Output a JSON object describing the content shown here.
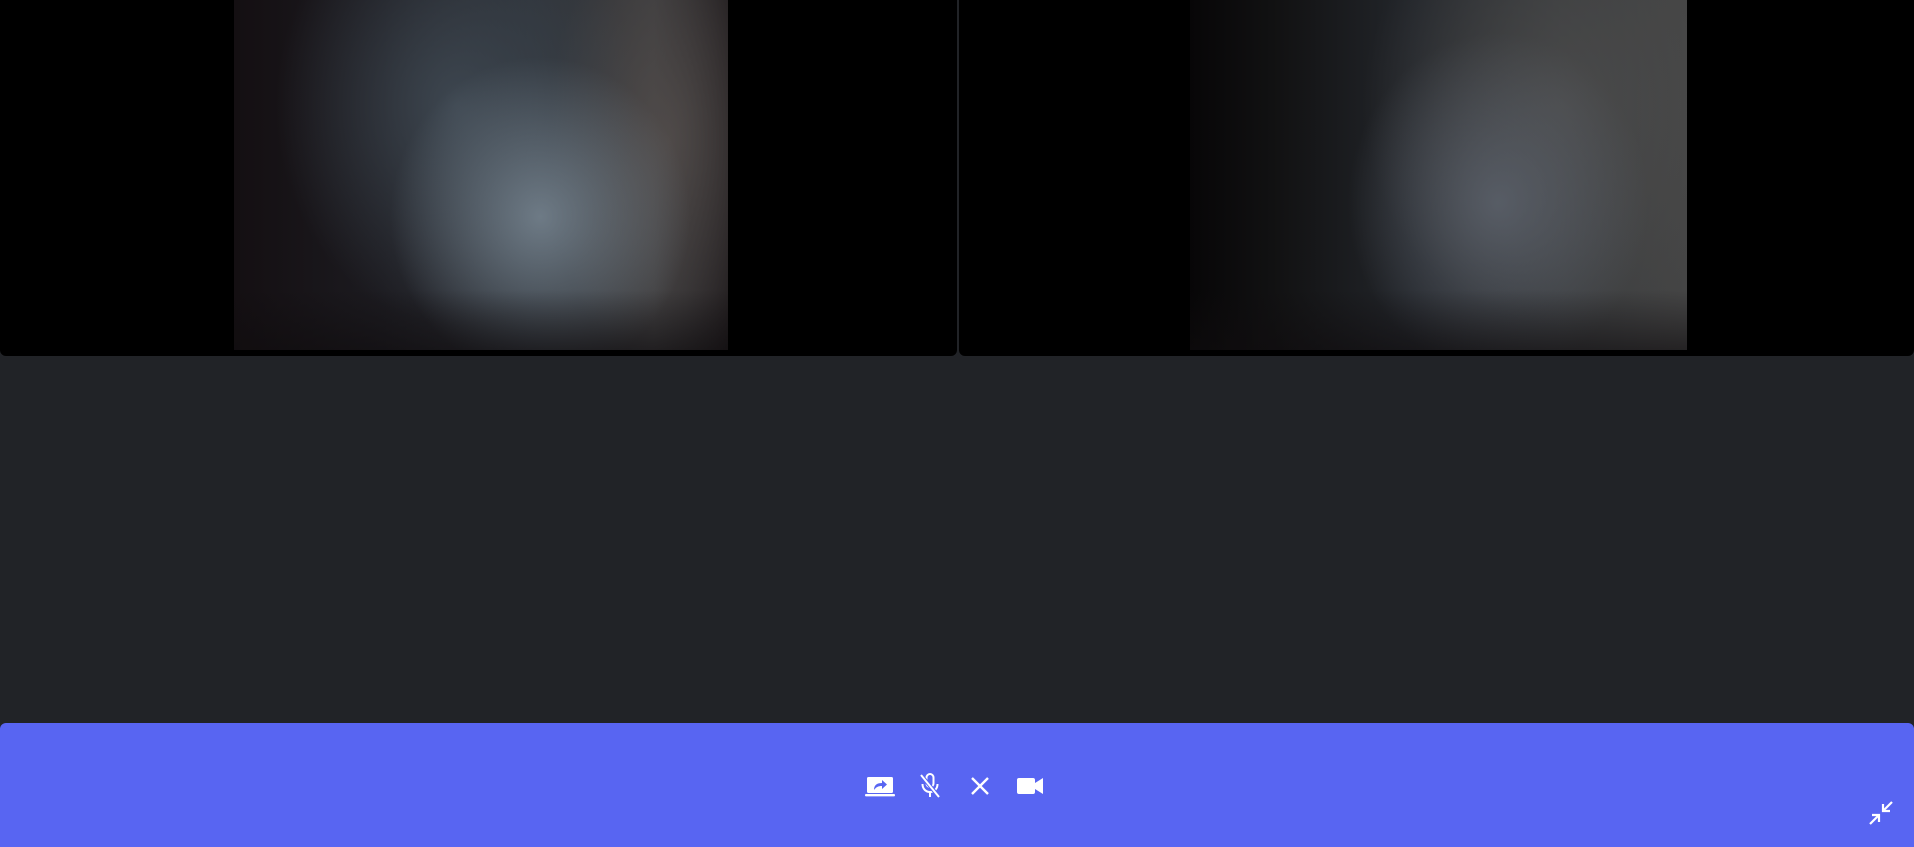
{
  "window": {
    "background": "#212327"
  },
  "participants": [
    {
      "tile_background": "#000000",
      "feed": "blurred-webcam-feed"
    },
    {
      "tile_background": "#000000",
      "feed": "blurred-webcam-feed"
    }
  ],
  "control_bar": {
    "background": "#5865f2",
    "icon_color": "#ffffff",
    "buttons": [
      {
        "icon": "screen-share-icon"
      },
      {
        "icon": "mic-muted-icon"
      },
      {
        "icon": "close-icon"
      },
      {
        "icon": "video-camera-icon"
      }
    ],
    "exit_fullscreen_icon": "exit-fullscreen-icon"
  }
}
